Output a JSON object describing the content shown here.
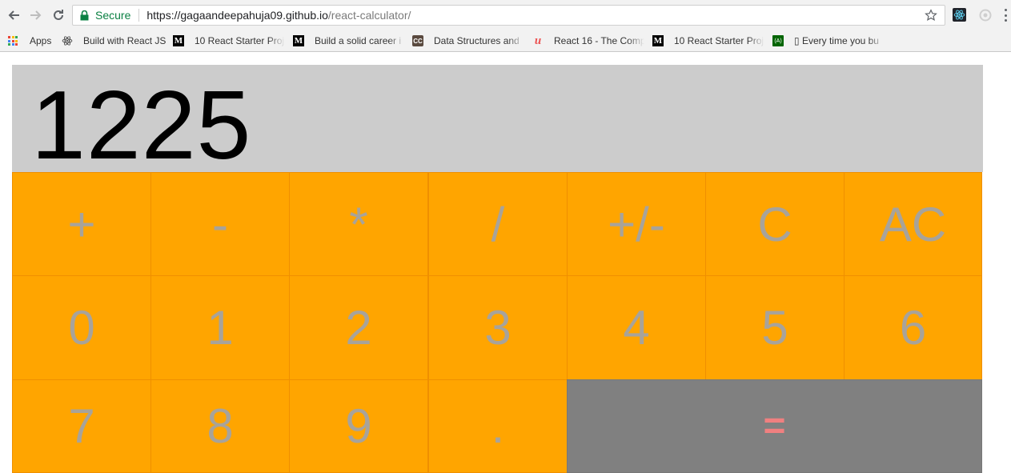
{
  "browser": {
    "secure_label": "Secure",
    "url_host": "https://gagaandeepahuja09.github.io",
    "url_path": "/react-calculator/"
  },
  "bookmarks": [
    {
      "label": "Apps",
      "icon": "apps-grid-icon"
    },
    {
      "label": "Build with React JS",
      "icon": "react-atom-icon"
    },
    {
      "label": "10 React Starter Proj",
      "icon": "medium-icon"
    },
    {
      "label": "Build a solid career i",
      "icon": "medium-icon"
    },
    {
      "label": "Data Structures and",
      "icon": "cc-icon"
    },
    {
      "label": "React 16 - The Comp",
      "icon": "udemy-icon"
    },
    {
      "label": "10 React Starter Proj",
      "icon": "medium-icon"
    },
    {
      "label": "▯ Every time you bu",
      "icon": "green-site-icon"
    }
  ],
  "calculator": {
    "display": "1225",
    "keys": {
      "plus": "+",
      "minus": "-",
      "multiply": "*",
      "divide": "/",
      "sign": "+/-",
      "clear": "C",
      "all_clear": "AC",
      "d0": "0",
      "d1": "1",
      "d2": "2",
      "d3": "3",
      "d4": "4",
      "d5": "5",
      "d6": "6",
      "d7": "7",
      "d8": "8",
      "d9": "9",
      "decimal": ".",
      "equals": "="
    }
  },
  "colors": {
    "key_bg": "#ffa500",
    "key_text": "#a8a39a",
    "equals_bg": "#808080",
    "equals_text": "#f08080",
    "display_bg": "#cccccc",
    "secure_green": "#0b8043"
  }
}
